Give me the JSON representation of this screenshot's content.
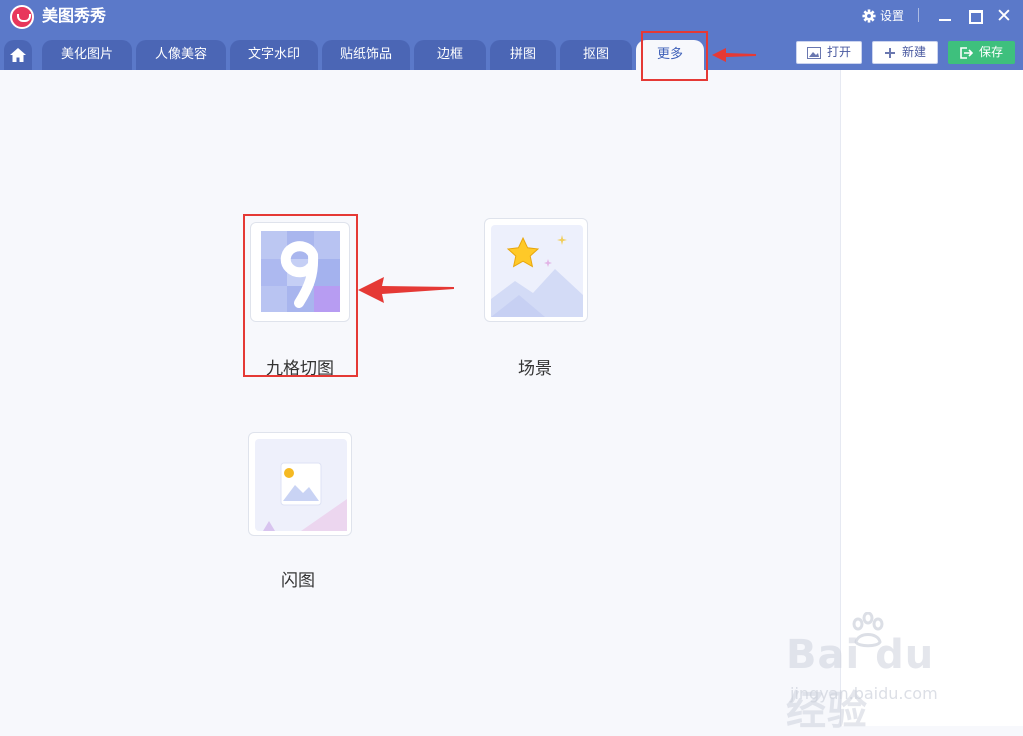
{
  "app": {
    "title": "美图秀秀"
  },
  "window": {
    "settings_label": "设置",
    "close_glyph": "✕"
  },
  "tabs": [
    {
      "label": "美化图片"
    },
    {
      "label": "人像美容"
    },
    {
      "label": "文字水印"
    },
    {
      "label": "贴纸饰品"
    },
    {
      "label": "边框"
    },
    {
      "label": "拼图"
    },
    {
      "label": "抠图"
    },
    {
      "label": "更多",
      "active": true
    }
  ],
  "toolbar": {
    "open_label": "打开",
    "new_label": "新建",
    "save_label": "保存",
    "save_color": "#3ec07d"
  },
  "tools": [
    {
      "label": "九格切图",
      "icon": "nine-grid-icon",
      "highlighted": true
    },
    {
      "label": "场景",
      "icon": "scene-icon"
    },
    {
      "label": "闪图",
      "icon": "flash-image-icon"
    }
  ],
  "watermark": {
    "logo": "Bai du 经验",
    "site": "jingyan.baidu.com"
  },
  "colors": {
    "titlebar": "#5b79c9",
    "tab": "#4b66b5",
    "highlight": "#e53935",
    "brand": "#e8375c"
  }
}
